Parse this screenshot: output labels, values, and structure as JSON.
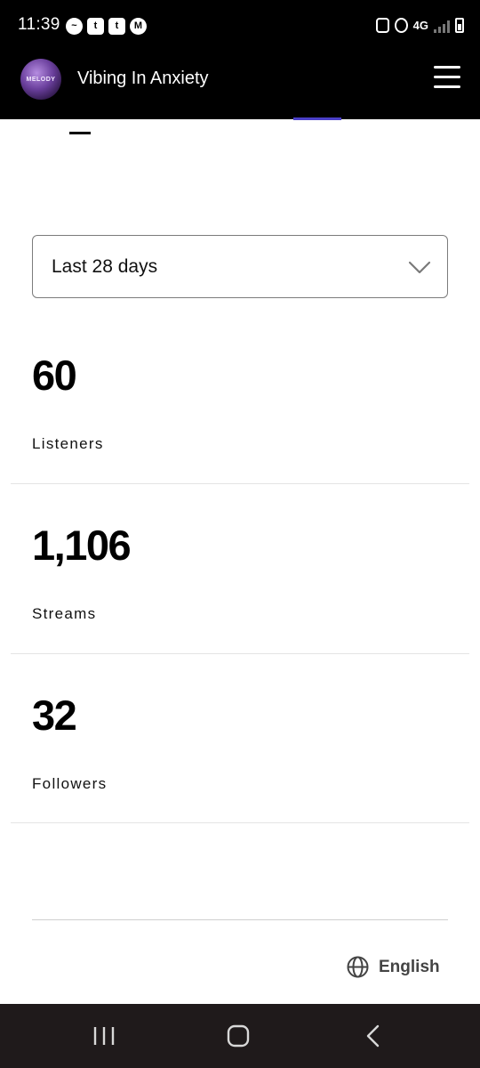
{
  "status_bar": {
    "time": "11:39",
    "notification_icons": [
      "messenger-icon",
      "twitch-icon",
      "twitch-icon",
      "app-m-icon"
    ],
    "network": "4G"
  },
  "header": {
    "avatar_text": "MELODY",
    "artist_name": "Vibing In Anxiety"
  },
  "period_select": {
    "selected": "Last 28 days"
  },
  "stats": [
    {
      "value": "60",
      "label": "Listeners"
    },
    {
      "value": "1,106",
      "label": "Streams"
    },
    {
      "value": "32",
      "label": "Followers"
    }
  ],
  "footer": {
    "language": "English"
  },
  "colors": {
    "header_bg": "#000000",
    "accent_tab": "#4a3fc7",
    "nav_bg": "#1f1a1b"
  }
}
